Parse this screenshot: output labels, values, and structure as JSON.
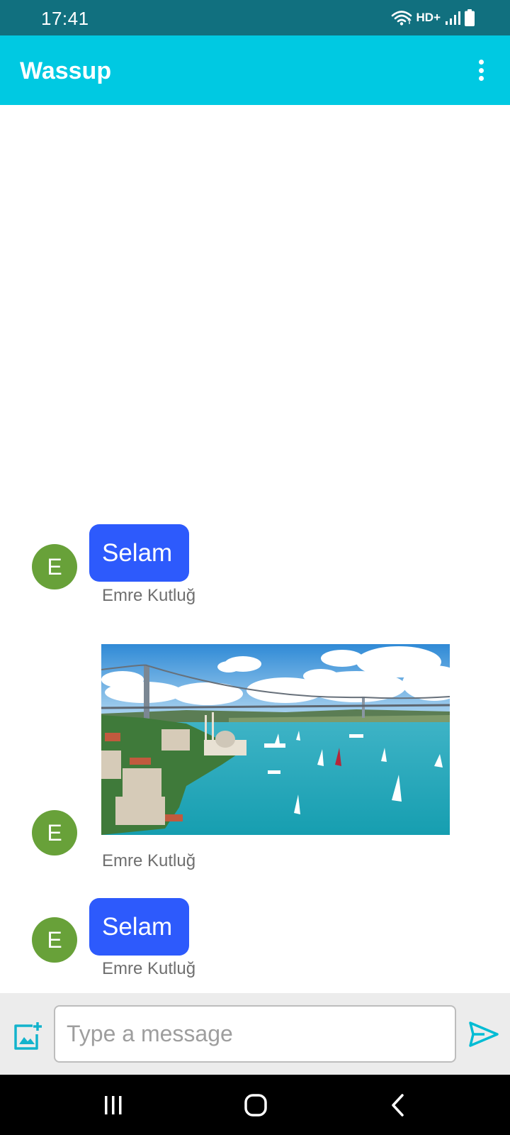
{
  "status_bar": {
    "time": "17:41",
    "network_label": "HD+",
    "icons": [
      "wifi-icon",
      "signal-icon",
      "battery-icon"
    ]
  },
  "app_bar": {
    "title": "Wassup",
    "menu_icon": "more-vert-icon"
  },
  "messages": [
    {
      "type": "text",
      "avatar_initial": "E",
      "text": "Selam",
      "sender": "Emre Kutluğ"
    },
    {
      "type": "image",
      "avatar_initial": "E",
      "image_description": "Bosphorus bridge with sailboats",
      "sender": "Emre Kutluğ"
    },
    {
      "type": "text",
      "avatar_initial": "E",
      "text": "Selam",
      "sender": "Emre Kutluğ"
    }
  ],
  "input_bar": {
    "attach_icon": "add-photo-icon",
    "placeholder": "Type a message",
    "value": "",
    "send_icon": "send-icon"
  },
  "nav_bar": {
    "icons": [
      "recents-icon",
      "home-icon",
      "back-icon"
    ]
  },
  "colors": {
    "status_bar": "#11707f",
    "app_bar": "#00c9e2",
    "bubble": "#2d5afc",
    "avatar": "#68a139",
    "input_bar": "#ececec",
    "send_icon": "#00bcd4"
  }
}
